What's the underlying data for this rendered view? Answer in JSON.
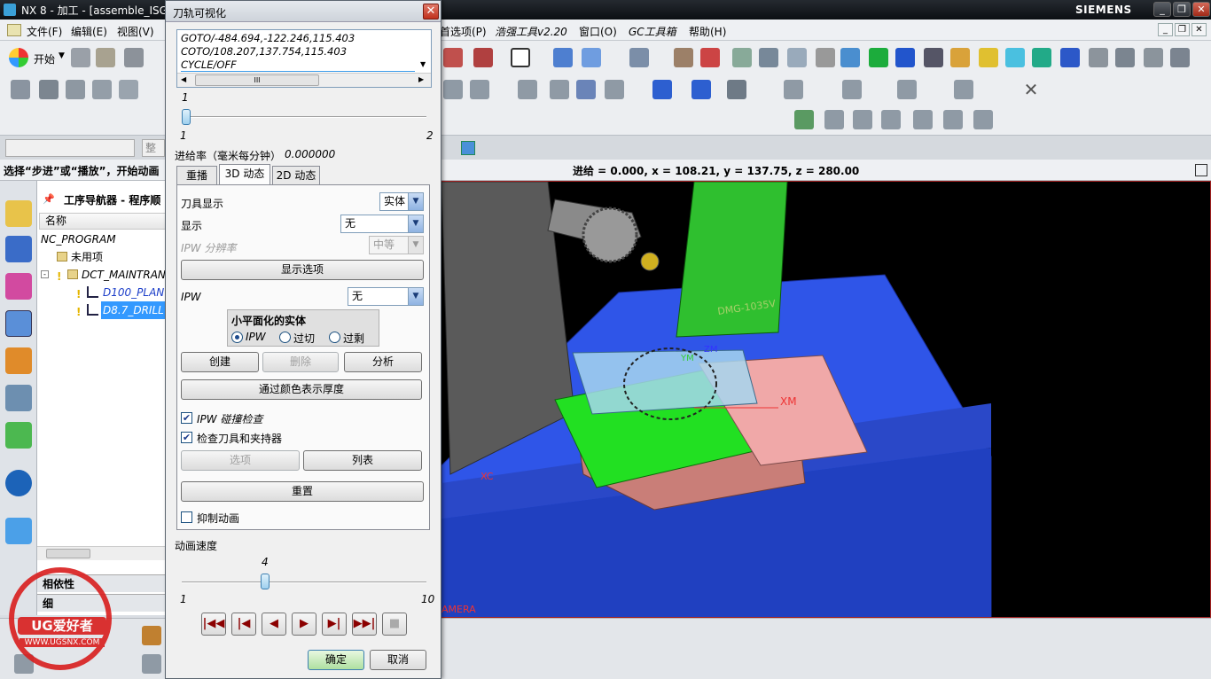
{
  "window": {
    "title": "NX 8 - 加工 - [assemble_ISG",
    "brand": "SIEMENS"
  },
  "menubar": {
    "items": [
      "文件(F)",
      "编辑(E)",
      "视图(V)",
      "首选项(P)",
      "浩强工具v2.20",
      "窗口(O)",
      "GC工具箱",
      "帮助(H)"
    ]
  },
  "toolbar": {
    "start_label": "开始"
  },
  "selection_bar": {
    "filter_value": "整个"
  },
  "status": {
    "prompt": "选择“步进”或“播放”，开始动画",
    "feedrate_info": "进给 = 0.000, x = 108.21, y = 137.75, z = 280.00"
  },
  "navigator": {
    "title": "工序导航器 - 程序顺",
    "column_header": "名称",
    "rows": [
      {
        "label": "NC_PROGRAM"
      },
      {
        "label": "未用项"
      },
      {
        "label": "DCT_MAINTRAN"
      },
      {
        "label": "D100_PLAN"
      },
      {
        "label": "D8.7_DRILL"
      }
    ],
    "bottom_tabs": [
      "相依性",
      "细"
    ]
  },
  "dialog": {
    "title": "刀轨可视化",
    "code_lines": [
      "GOTO/-484.694,-122.246,115.403",
      "COTO/108.207,137.754,115.403",
      "CYCLE/OFF"
    ],
    "code_scroll_label": "III",
    "step_slider": {
      "value": 1,
      "min": 1,
      "max": 2,
      "value_label": "1",
      "min_label": "1",
      "max_label": "2"
    },
    "feed_label": "进给率（毫米每分钟）",
    "feed_value": "0.000000",
    "tabs": [
      "重播",
      "3D 动态",
      "2D 动态"
    ],
    "active_tab": "3D 动态",
    "tool_display_label": "刀具显示",
    "tool_display_value": "实体",
    "display_label": "显示",
    "display_value": "无",
    "ipw_resolution_label": "IPW 分辨率",
    "ipw_resolution_value": "中等",
    "display_options_button": "显示选项",
    "ipw_label": "IPW",
    "ipw_value": "无",
    "facet_group_title": "小平面化的实体",
    "facet_options": [
      "IPW",
      "过切",
      "过剩"
    ],
    "facet_selected": "IPW",
    "create_button": "创建",
    "delete_button": "删除",
    "analyze_button": "分析",
    "thickness_button": "通过颜色表示厚度",
    "ipw_collision_label": "IPW 碰撞检查",
    "ipw_collision_checked": true,
    "check_holder_label": "检查刀具和夹持器",
    "check_holder_checked": true,
    "options_button": "选项",
    "list_button": "列表",
    "reset_button": "重置",
    "suppress_label": "抑制动画",
    "suppress_checked": false,
    "speed_label": "动画速度",
    "speed_slider": {
      "value": 4,
      "min": 1,
      "max": 10,
      "value_label": "4",
      "min_label": "1",
      "max_label": "10"
    },
    "ok_button": "确定",
    "cancel_button": "取消"
  },
  "viewport": {
    "labels": {
      "machine_text": "DMG-1035V",
      "xm": "XM",
      "ym": "YM",
      "zm": "ZM",
      "xc": "XC",
      "camera": "AMERA"
    },
    "colors": {
      "background": "#000000",
      "base": "#2d4ee0",
      "spindle": "#2fbf2f",
      "table": "#e8a0a0",
      "workpiece": "#a6d6ee"
    }
  },
  "watermark": {
    "brand": "UG爱好者",
    "url": "WWW.UGSNX.COM"
  }
}
